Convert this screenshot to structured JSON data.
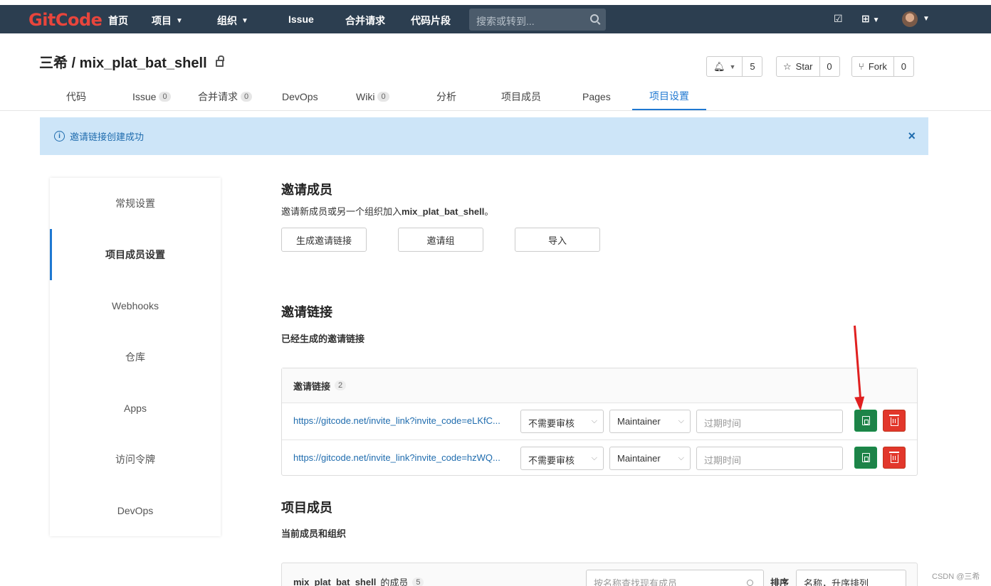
{
  "brand": {
    "logo_text": "GitCode",
    "logo_color": "#e8453c"
  },
  "nav": {
    "items": [
      {
        "label": "首页"
      },
      {
        "label": "项目"
      },
      {
        "label": "组织"
      },
      {
        "label": "Issue"
      },
      {
        "label": "合并请求"
      },
      {
        "label": "代码片段"
      }
    ],
    "search_placeholder": "搜索或转到...",
    "icons": [
      "edit-icon",
      "plus-icon",
      "avatar"
    ]
  },
  "project": {
    "title": "三希 / mix_plat_bat_shell",
    "notify_count": "5",
    "star_label": "Star",
    "star_count": "0",
    "fork_label": "Fork",
    "fork_count": "0"
  },
  "tabs": [
    {
      "label": "代码",
      "badge": ""
    },
    {
      "label": "Issue",
      "badge": "0"
    },
    {
      "label": "合并请求",
      "badge": "0"
    },
    {
      "label": "DevOps",
      "badge": ""
    },
    {
      "label": "Wiki",
      "badge": "0"
    },
    {
      "label": "分析",
      "badge": ""
    },
    {
      "label": "项目成员",
      "badge": ""
    },
    {
      "label": "Pages",
      "badge": ""
    },
    {
      "label": "项目设置",
      "badge": "",
      "active": true
    }
  ],
  "alert": {
    "text": "邀请链接创建成功",
    "close": "×"
  },
  "sidebar": {
    "items": [
      {
        "label": "常规设置"
      },
      {
        "label": "项目成员设置",
        "active": true
      },
      {
        "label": "Webhooks"
      },
      {
        "label": "仓库"
      },
      {
        "label": "Apps"
      },
      {
        "label": "访问令牌"
      },
      {
        "label": "DevOps"
      }
    ]
  },
  "invite": {
    "title": "邀请成员",
    "desc_prefix": "邀请新成员或另一个组织加入",
    "desc_project": "mix_plat_bat_shell",
    "desc_suffix": "。",
    "buttons": {
      "generate": "生成邀请链接",
      "group": "邀请组",
      "import": "导入"
    }
  },
  "links": {
    "title": "邀请链接",
    "subtitle": "已经生成的邀请链接",
    "panel_title": "邀请链接",
    "count": "2",
    "expiry_placeholder": "过期时间",
    "rows": [
      {
        "url": "https://gitcode.net/invite_link?invite_code=eLKfC...",
        "approval": "不需要审核",
        "role": "Maintainer"
      },
      {
        "url": "https://gitcode.net/invite_link?invite_code=hzWQ...",
        "approval": "不需要审核",
        "role": "Maintainer"
      }
    ]
  },
  "members": {
    "title": "项目成员",
    "subtitle": "当前成员和组织",
    "panel_project": "mix_plat_bat_shell",
    "panel_suffix": "的成员",
    "count": "5",
    "search_placeholder": "按名称查找现有成员",
    "sort_label": "排序",
    "sort_value": "名称，升序排列"
  },
  "watermark": "CSDN @三希",
  "colors": {
    "nav_bg": "#2c3e50",
    "accent": "#1f78d1",
    "copy_btn": "#1d8348",
    "delete_btn": "#e2372b",
    "alert_bg": "#cde5f8"
  }
}
